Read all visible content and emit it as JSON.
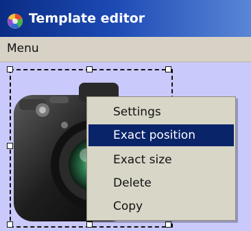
{
  "window": {
    "title": "Template editor"
  },
  "menubar": {
    "items": [
      "Menu"
    ]
  },
  "context_menu": {
    "items": [
      "Settings",
      "Exact position",
      "Exact size",
      "Delete",
      "Copy"
    ],
    "active_index": 1
  },
  "colors": {
    "canvas": "#c8c8fa",
    "titlebar_dark": "#0b2c84",
    "titlebar_light": "#5a86d6",
    "menu_bg": "#d7d2c5",
    "context_bg": "#d8d6c7",
    "context_active": "#0a246a"
  }
}
